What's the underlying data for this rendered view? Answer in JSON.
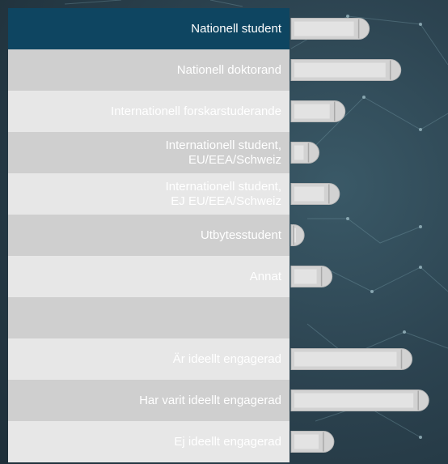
{
  "rows": [
    {
      "label": "Nationell student",
      "style": "dark"
    },
    {
      "label": "Nationell doktorand",
      "style": "gray"
    },
    {
      "label": "Internationell forskarstuderande",
      "style": "light"
    },
    {
      "label": "Internationell student,\nEU/EEA/Schweiz",
      "style": "gray"
    },
    {
      "label": "Internationell student,\nEJ  EU/EEA/Schweiz",
      "style": "light"
    },
    {
      "label": "Utbytesstudent",
      "style": "gray"
    },
    {
      "label": "Annat",
      "style": "light"
    },
    {
      "label": "",
      "style": "gray"
    },
    {
      "label": "Är ideellt engagerad",
      "style": "light"
    },
    {
      "label": "Har varit ideellt engagerad",
      "style": "gray"
    },
    {
      "label": "Ej ideellt engagerad",
      "style": "light"
    }
  ],
  "bars": [
    {
      "value": 0.42
    },
    {
      "value": 0.59
    },
    {
      "value": 0.29
    },
    {
      "value": 0.15
    },
    {
      "value": 0.26
    },
    {
      "value": 0.07
    },
    {
      "value": 0.22
    },
    {
      "value": null
    },
    {
      "value": 0.65
    },
    {
      "value": 0.74
    },
    {
      "value": 0.23
    }
  ],
  "colors": {
    "bar": "#d2d2d2",
    "bar_highlight": "#eeeeee",
    "dark_row": "#0e4561"
  }
}
